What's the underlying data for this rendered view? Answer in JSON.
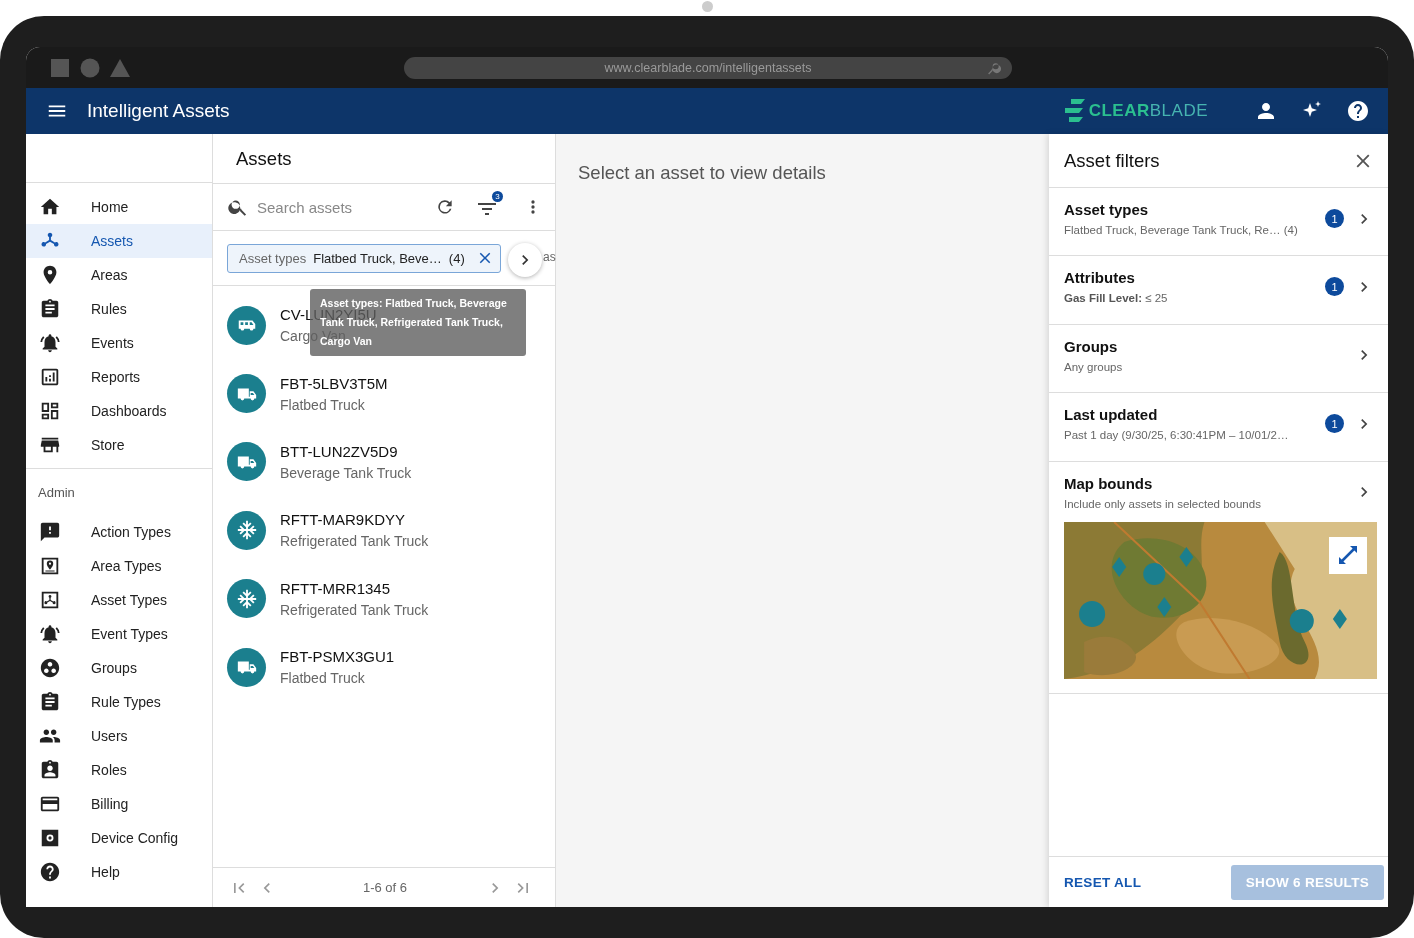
{
  "browser": {
    "url": "www.clearblade.com/intelligentassets"
  },
  "app_bar": {
    "title": "Intelligent Assets",
    "logo": {
      "strong": "CLEAR",
      "light": "BLADE"
    }
  },
  "sidebar": {
    "items": [
      {
        "label": "Home",
        "kind": "home",
        "selected": false
      },
      {
        "label": "Assets",
        "kind": "hub",
        "selected": true
      },
      {
        "label": "Areas",
        "kind": "pin",
        "selected": false
      },
      {
        "label": "Rules",
        "kind": "clipboard",
        "selected": false
      },
      {
        "label": "Events",
        "kind": "bell",
        "selected": false
      },
      {
        "label": "Reports",
        "kind": "chart",
        "selected": false
      },
      {
        "label": "Dashboards",
        "kind": "grid",
        "selected": false
      },
      {
        "label": "Store",
        "kind": "store",
        "selected": false
      }
    ],
    "section_title": "Admin",
    "admin_items": [
      {
        "label": "Action Types",
        "kind": "alert",
        "selected": false
      },
      {
        "label": "Area Types",
        "kind": "framedpin",
        "selected": false
      },
      {
        "label": "Asset Types",
        "kind": "framedhub",
        "selected": false
      },
      {
        "label": "Event Types",
        "kind": "bell",
        "selected": false
      },
      {
        "label": "Groups",
        "kind": "dots",
        "selected": false
      },
      {
        "label": "Rule Types",
        "kind": "clipboard",
        "selected": false
      },
      {
        "label": "Users",
        "kind": "people",
        "selected": false
      },
      {
        "label": "Roles",
        "kind": "badge",
        "selected": false
      },
      {
        "label": "Billing",
        "kind": "card",
        "selected": false
      },
      {
        "label": "Device Config",
        "kind": "gear",
        "selected": false
      },
      {
        "label": "Help",
        "kind": "help",
        "selected": false
      }
    ]
  },
  "asset_list": {
    "title": "Assets",
    "search": {
      "placeholder": "Search assets"
    },
    "filter_count": "3",
    "chips": [
      {
        "label": "Asset types",
        "value": "Flatbed Truck, Beve…",
        "count": "(4)"
      }
    ],
    "chip_fragment": "as",
    "tooltip": "Asset types: Flatbed Truck, Beverage Tank Truck, Refrigerated Tank Truck, Cargo Van",
    "assets": [
      {
        "name": "CV-LUN2YI5U",
        "type": "Cargo Van",
        "kind": "van"
      },
      {
        "name": "FBT-5LBV3T5M",
        "type": "Flatbed Truck",
        "kind": "truck"
      },
      {
        "name": "BTT-LUN2ZV5D9",
        "type": "Beverage Tank Truck",
        "kind": "truck"
      },
      {
        "name": "RFTT-MAR9KDYY",
        "type": "Refrigerated Tank Truck",
        "kind": "snow"
      },
      {
        "name": "RFTT-MRR1345",
        "type": "Refrigerated Tank Truck",
        "kind": "snow"
      },
      {
        "name": "FBT-PSMX3GU1",
        "type": "Flatbed Truck",
        "kind": "truck"
      }
    ],
    "pagination": "1-6 of 6"
  },
  "detail": {
    "message": "Select an asset to view details"
  },
  "filters": {
    "title": "Asset filters",
    "sections": [
      {
        "title": "Asset types",
        "summary": "Flatbed Truck, Beverage Tank Truck, Re…  (4)",
        "badge": "1"
      },
      {
        "title": "Attributes",
        "summary": "**Gas Fill Level:** ≤ 25",
        "badge": "1"
      },
      {
        "title": "Groups",
        "summary": "Any groups"
      },
      {
        "title": "Last updated",
        "summary": "Past 1 day (9/30/25, 6:30:41PM – 10/01/2…",
        "badge": "1"
      },
      {
        "title": "Map bounds",
        "summary": "Include only assets in selected bounds"
      }
    ],
    "reset": "RESET ALL",
    "apply": {
      "label": "SHOW 6 RESULTS",
      "disabled": true
    }
  }
}
